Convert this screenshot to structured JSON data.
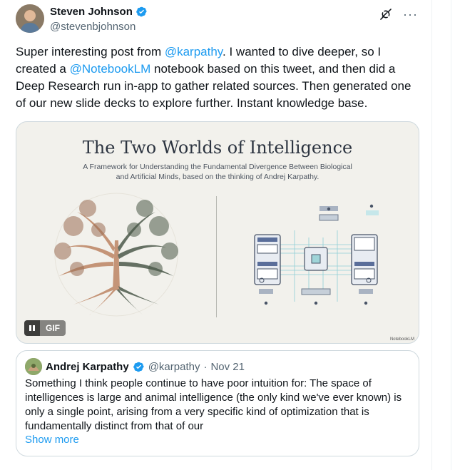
{
  "author": {
    "display_name": "Steven Johnson",
    "handle": "@stevenbjohnson",
    "verified": true
  },
  "icons": {
    "grok": "grok-icon",
    "more": "more-icon",
    "verified": "verified-badge-icon",
    "pause": "pause-icon"
  },
  "tweet": {
    "text_1": "Super interesting post from ",
    "mention_1": "@karpathy",
    "text_2": ". I wanted to dive deeper, so I created a ",
    "mention_2": "@NotebookLM",
    "text_3": " notebook based on this tweet, and then did a Deep Research run in-app to gather related sources. Then generated one of our new slide decks to explore further. Instant knowledge base."
  },
  "media": {
    "slide_title": "The Two Worlds of Intelligence",
    "slide_subtitle_line1": "A Framework for Understanding the Fundamental Divergence Between Biological",
    "slide_subtitle_line2": "and Artificial Minds, based on the thinking of Andrej Karpathy.",
    "gif_label": "GIF",
    "watermark": "NotebookLM"
  },
  "quote": {
    "display_name": "Andrej Karpathy",
    "handle": "@karpathy",
    "separator": "·",
    "date": "Nov 21",
    "text": "Something I think people continue to have poor intuition for: The space of intelligences is large and animal intelligence (the only kind we've ever known) is only a single point, arising from a very specific kind of optimization that is fundamentally distinct from that of our",
    "show_more": "Show more"
  },
  "colors": {
    "link": "#1d9bf0",
    "text": "#0f1419",
    "muted": "#536471",
    "border": "#cfd9de",
    "slide_bg": "#f2f1ec"
  }
}
